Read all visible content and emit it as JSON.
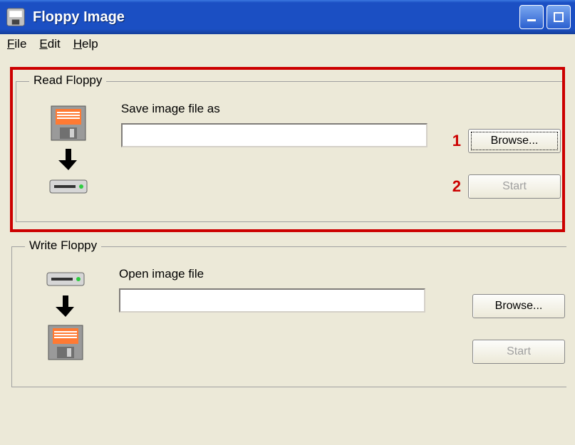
{
  "titlebar": {
    "title": "Floppy Image"
  },
  "menu": {
    "file": "File",
    "edit": "Edit",
    "help": "Help"
  },
  "read": {
    "legend": "Read Floppy",
    "label": "Save image file as",
    "value": "",
    "browse": "Browse...",
    "start": "Start",
    "annot1": "1",
    "annot2": "2"
  },
  "write": {
    "legend": "Write Floppy",
    "label": "Open image file",
    "value": "",
    "browse": "Browse...",
    "start": "Start"
  }
}
